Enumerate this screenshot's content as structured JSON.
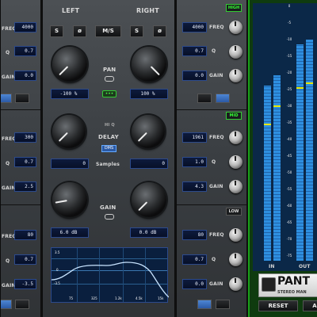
{
  "left_eq": {
    "bands": [
      {
        "freq": "",
        "q": "",
        "gain": "",
        "freq_label": "FREQ",
        "q_label": "Q",
        "gain_label": "GAIN"
      },
      {
        "freq": "4000",
        "q": "0.7",
        "gain": "0.0"
      },
      {
        "freq": "300",
        "q": "0.7",
        "gain": "2.5"
      },
      {
        "freq": "80",
        "q": "0.7",
        "gain": "-3.5"
      }
    ]
  },
  "center": {
    "left_label": "LEFT",
    "right_label": "RIGHT",
    "buttons": {
      "s_left": "S",
      "phase_left": "ø",
      "ms": "M/S",
      "s_right": "S",
      "phase_right": "ø"
    },
    "pan": {
      "label": "PAN",
      "left_value": "-100",
      "left_unit": "%",
      "right_value": "100",
      "right_unit": "%"
    },
    "delay": {
      "label": "DELAY",
      "hiq_label": "HI Q",
      "ms_label": "DMS",
      "unit_label": "Samples",
      "left_value": "0",
      "right_value": "0"
    },
    "gain": {
      "label": "GAIN",
      "left_value": "6.0",
      "left_unit": "dB",
      "right_value": "0.0",
      "right_unit": "dB"
    },
    "graph": {
      "y_ticks": [
        "3.5",
        "0",
        "-3.5"
      ],
      "x_ticks": [
        "75",
        "325",
        "1.2k",
        "4.5k",
        "15k"
      ]
    }
  },
  "right_eq": {
    "high": {
      "badge": "HIGH",
      "freq": "4000",
      "q": "0.7",
      "gain": "0.0"
    },
    "mid": {
      "badge": "MID",
      "freq": "1961",
      "q": "1.0",
      "gain": "4.3"
    },
    "low": {
      "badge": "LOW",
      "freq": "80",
      "q": "0.7",
      "gain": "0.0"
    },
    "labels": {
      "freq": "FREQ",
      "q": "Q",
      "gain": "GAIN"
    }
  },
  "meter": {
    "ticks": [
      "0",
      "-5",
      "-10",
      "-15",
      "-20",
      "-25",
      "-30",
      "-35",
      "-40",
      "-45",
      "-50",
      "-55",
      "-60",
      "-65",
      "-70",
      "-75"
    ],
    "in_label": "IN",
    "out_label": "OUT",
    "levels": {
      "in_l": 0.68,
      "in_r": 0.72,
      "out_l": 0.84,
      "out_r": 0.86
    },
    "peaks": {
      "in_l": 0.57,
      "in_r": 0.64,
      "out_l": 0.71,
      "out_r": 0.73
    }
  },
  "branding": {
    "name": "PANT",
    "subtitle": "STEREO MAN"
  },
  "footer": {
    "reset": "RESET",
    "right_btn": "A"
  },
  "colors": {
    "accent_green": "#1aa01a",
    "meter_blue": "#2e8fe0",
    "peak_yellow": "#e8e800",
    "field_blue": "#2c4a8c"
  }
}
